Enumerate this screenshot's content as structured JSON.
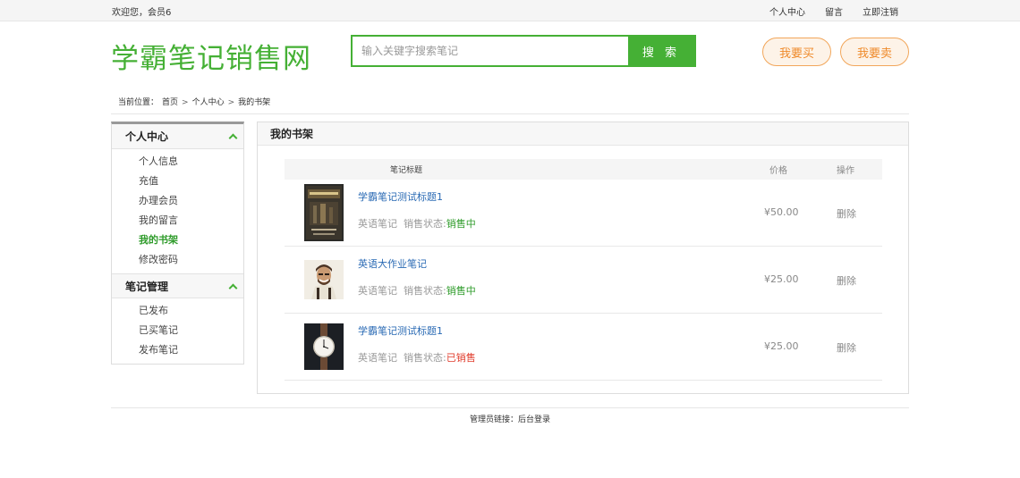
{
  "topbar": {
    "welcome": "欢迎您，会员6",
    "links": [
      "个人中心",
      "留言",
      "立即注销"
    ]
  },
  "header": {
    "logo": "学霸笔记销售网",
    "search_placeholder": "输入关键字搜索笔记",
    "search_button": "搜 索",
    "buy_button": "我要买",
    "sell_button": "我要卖"
  },
  "breadcrumb": {
    "label": "当前位置：",
    "items": [
      "首页",
      "个人中心",
      "我的书架"
    ],
    "separator": ">"
  },
  "sidebar": {
    "groups": [
      {
        "title": "个人中心",
        "items": [
          "个人信息",
          "充值",
          "办理会员",
          "我的留言",
          "我的书架",
          "修改密码"
        ],
        "active": "我的书架"
      },
      {
        "title": "笔记管理",
        "items": [
          "已发布",
          "已买笔记",
          "发布笔记"
        ]
      }
    ]
  },
  "main": {
    "title": "我的书架",
    "headers": {
      "title": "笔记标题",
      "price": "价格",
      "op": "操作"
    },
    "rows": [
      {
        "title": "学霸笔记测试标题1",
        "category": "英语笔记",
        "status_label": "销售状态:",
        "status": "销售中",
        "status_color": "#2e9b2a",
        "price": "¥50.00",
        "action": "删除",
        "thumb": "book-cover"
      },
      {
        "title": "英语大作业笔记",
        "category": "英语笔记",
        "status_label": "销售状态:",
        "status": "销售中",
        "status_color": "#2e9b2a",
        "price": "¥25.00",
        "action": "删除",
        "thumb": "person-photo"
      },
      {
        "title": "学霸笔记测试标题1",
        "category": "英语笔记",
        "status_label": "销售状态:",
        "status": "已销售",
        "status_color": "#e03c2c",
        "price": "¥25.00",
        "action": "删除",
        "thumb": "watch-photo"
      }
    ]
  },
  "footer": {
    "label": "管理员链接：",
    "link": "后台登录"
  },
  "colors": {
    "brand_green": "#45b035",
    "accent_orange": "#ef8a2a",
    "link_blue": "#2a6ab4",
    "sold_red": "#e03c2c"
  }
}
